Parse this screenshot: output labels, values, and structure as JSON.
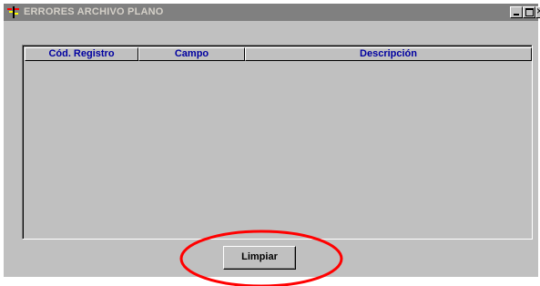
{
  "window": {
    "title": "ERRORES ARCHIVO PLANO",
    "titlebar_color": "#808080",
    "body_color": "#c0c0c0"
  },
  "icons": {
    "app": "app-icon",
    "minimize": "minimize-icon",
    "maximize": "maximize-icon",
    "close": "close-icon"
  },
  "grid": {
    "columns": [
      "Cód. Registro",
      "Campo",
      "Descripción"
    ],
    "rows": [],
    "header_text_color": "#0000a0"
  },
  "actions": {
    "clear_label": "Limpiar"
  },
  "annotation": {
    "shape": "ellipse",
    "color": "#ff0000",
    "target": "clear-button"
  }
}
